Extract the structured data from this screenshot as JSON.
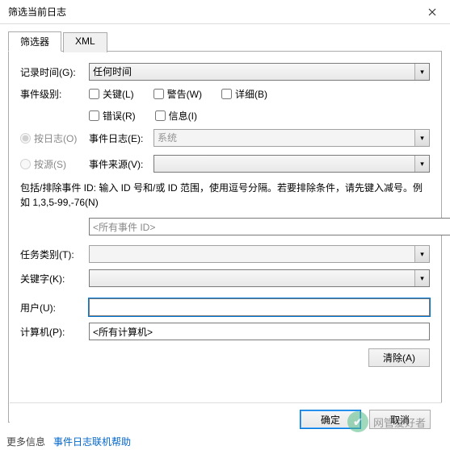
{
  "window": {
    "title": "筛选当前日志"
  },
  "tabs": {
    "filter": "筛选器",
    "xml": "XML"
  },
  "labels": {
    "logged": "记录时间(G):",
    "level": "事件级别:",
    "byLog": "按日志(O)",
    "bySource": "按源(S)",
    "eventLog": "事件日志(E):",
    "eventSource": "事件来源(V):",
    "help": "包括/排除事件 ID: 输入 ID 号和/或 ID 范围，使用逗号分隔。若要排除条件，请先键入减号。例如 1,3,5-99,-76(N)",
    "task": "任务类别(T):",
    "keywords": "关键字(K):",
    "user": "用户(U):",
    "computer": "计算机(P):",
    "clear": "清除(A)",
    "ok": "确定",
    "cancel": "取消"
  },
  "values": {
    "logged": "任何时间",
    "eventLog": "系统",
    "eventSource": "",
    "eventId": "<所有事件 ID>",
    "task": "",
    "keywords": "",
    "user": "",
    "computer": "<所有计算机>"
  },
  "checks": {
    "critical": "关键(L)",
    "warning": "警告(W)",
    "verbose": "详细(B)",
    "error": "错误(R)",
    "info": "信息(I)"
  },
  "watermark": "网管爱好者",
  "bottom": {
    "more": "更多信息",
    "link": "事件日志联机帮助"
  }
}
